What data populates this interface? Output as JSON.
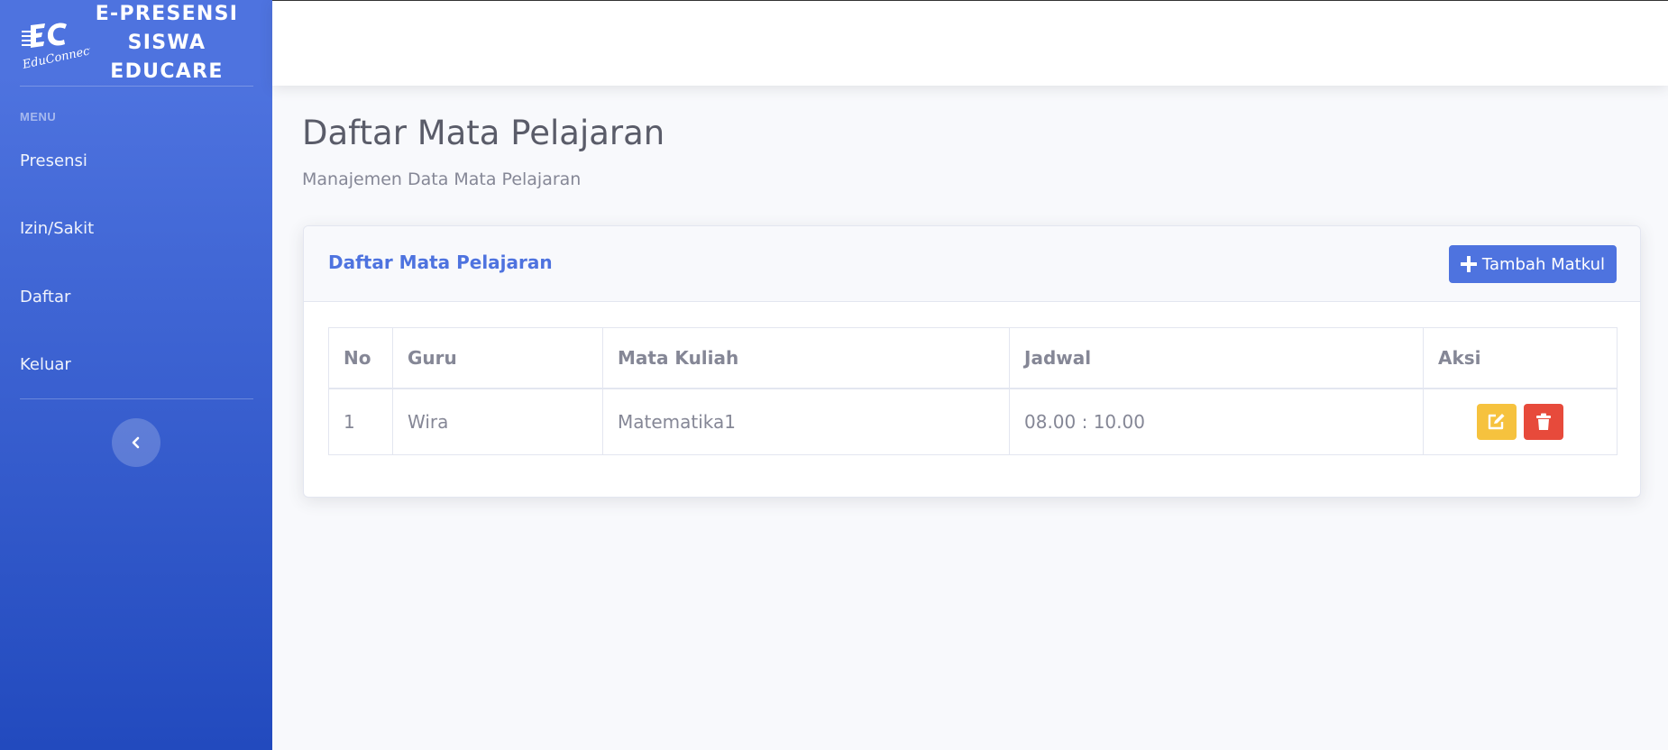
{
  "sidebar": {
    "brand_lines": [
      "E-PRESENSI",
      "SISWA",
      "EDUCARE"
    ],
    "logo_text": "EduConnect",
    "menu_heading": "MENU",
    "items": [
      {
        "label": "Presensi"
      },
      {
        "label": "Izin/Sakit"
      },
      {
        "label": "Daftar"
      },
      {
        "label": "Keluar"
      }
    ]
  },
  "page": {
    "title": "Daftar Mata Pelajaran",
    "subtitle": "Manajemen Data Mata Pelajaran"
  },
  "card": {
    "title": "Daftar Mata Pelajaran",
    "add_button": "Tambah Matkul"
  },
  "table": {
    "headers": [
      "No",
      "Guru",
      "Mata Kuliah",
      "Jadwal",
      "Aksi"
    ],
    "rows": [
      {
        "no": "1",
        "guru": "Wira",
        "mata_kuliah": "Matematika1",
        "jadwal": "08.00 : 10.00"
      }
    ]
  },
  "colors": {
    "primary": "#4e73df",
    "warning": "#f6c23e",
    "danger": "#e74a3b",
    "text": "#858796"
  }
}
